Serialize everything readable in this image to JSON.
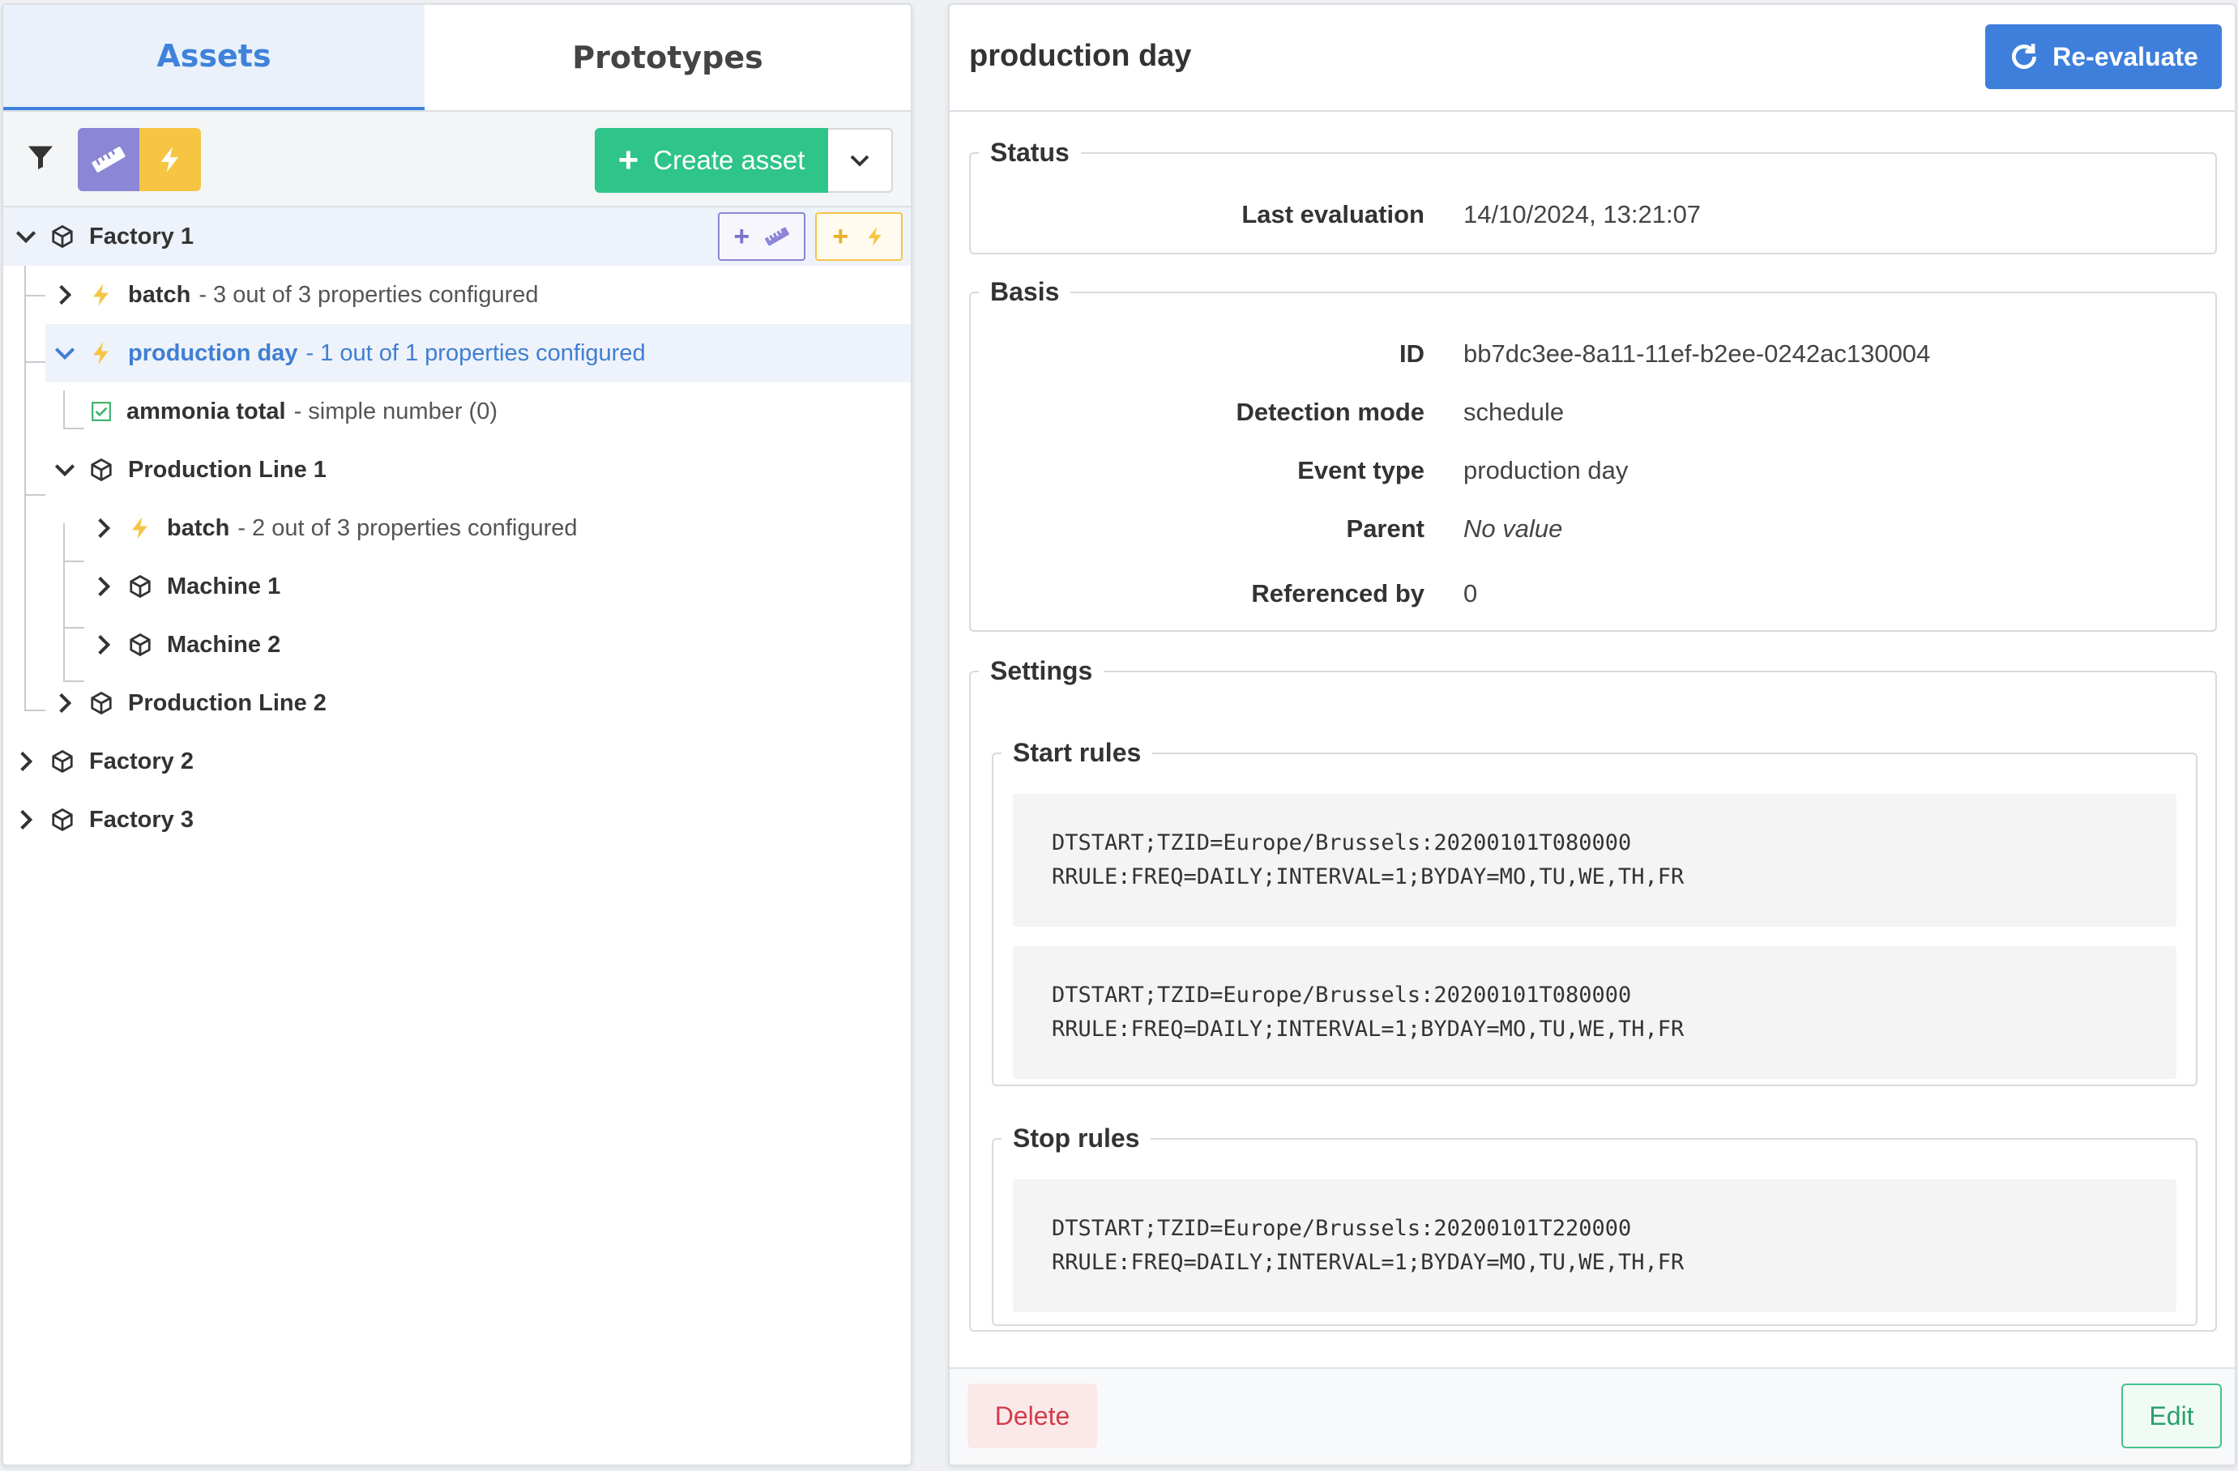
{
  "tabs": {
    "assets": "Assets",
    "prototypes": "Prototypes"
  },
  "toolbar": {
    "create_label": "Create asset"
  },
  "colors": {
    "accent": "#3f7fdc",
    "success": "#2ec48a",
    "measure": "#8b86d5",
    "event": "#f6c544",
    "danger": "#d23c4a"
  },
  "tree": {
    "factory1": {
      "label": "Factory 1"
    },
    "batch1": {
      "label": "batch",
      "desc": "- 3 out of 3 properties configured"
    },
    "production_day": {
      "label": "production day",
      "desc": "- 1 out of 1 properties configured"
    },
    "ammonia": {
      "label": "ammonia total",
      "desc": "- simple number (0)"
    },
    "pl1": {
      "label": "Production Line 1"
    },
    "batch2": {
      "label": "batch",
      "desc": "- 2 out of 3 properties configured"
    },
    "machine1": {
      "label": "Machine 1"
    },
    "machine2": {
      "label": "Machine 2"
    },
    "pl2": {
      "label": "Production Line 2"
    },
    "factory2": {
      "label": "Factory 2"
    },
    "factory3": {
      "label": "Factory 3"
    }
  },
  "detail": {
    "title": "production day",
    "reevaluate_label": "Re-evaluate",
    "status": {
      "legend": "Status",
      "last_evaluation_label": "Last evaluation",
      "last_evaluation_value": "14/10/2024, 13:21:07"
    },
    "basis": {
      "legend": "Basis",
      "id_label": "ID",
      "id_value": "bb7dc3ee-8a11-11ef-b2ee-0242ac130004",
      "detection_label": "Detection mode",
      "detection_value": "schedule",
      "event_type_label": "Event type",
      "event_type_value": "production day",
      "parent_label": "Parent",
      "parent_value": "No value",
      "referenced_label": "Referenced by",
      "referenced_value": "0"
    },
    "settings": {
      "legend": "Settings",
      "start_rules_legend": "Start rules",
      "start_rules": [
        "DTSTART;TZID=Europe/Brussels:20200101T080000\nRRULE:FREQ=DAILY;INTERVAL=1;BYDAY=MO,TU,WE,TH,FR",
        "DTSTART;TZID=Europe/Brussels:20200101T080000\nRRULE:FREQ=DAILY;INTERVAL=1;BYDAY=MO,TU,WE,TH,FR"
      ],
      "stop_rules_legend": "Stop rules",
      "stop_rules": [
        "DTSTART;TZID=Europe/Brussels:20200101T220000\nRRULE:FREQ=DAILY;INTERVAL=1;BYDAY=MO,TU,WE,TH,FR"
      ]
    },
    "delete_label": "Delete",
    "edit_label": "Edit"
  }
}
